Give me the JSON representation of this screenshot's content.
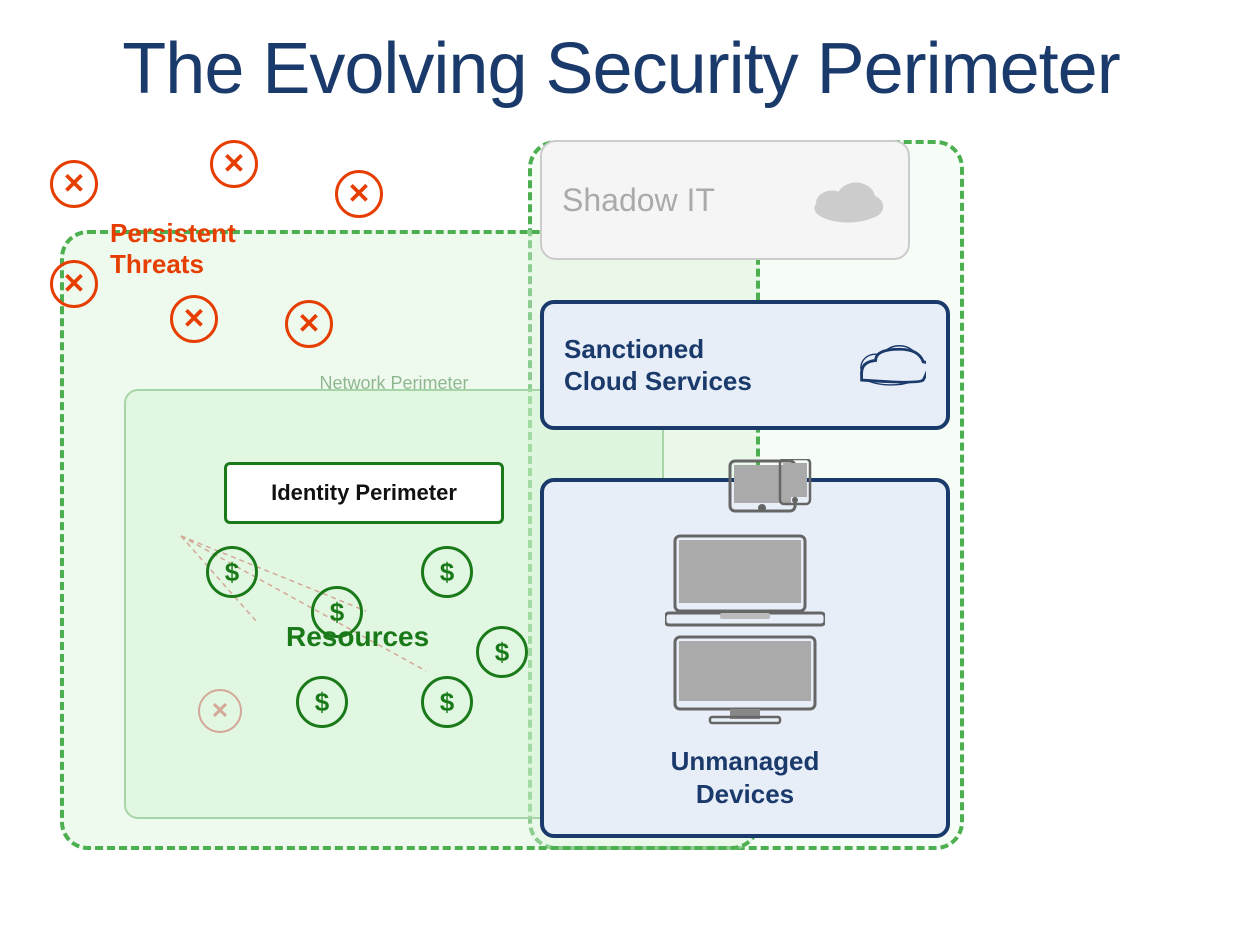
{
  "title": "The Evolving Security Perimeter",
  "zones": {
    "identity_perimeter": "Identity Perimeter",
    "network_perimeter": "Network Perimeter",
    "shadow_it": "Shadow IT",
    "sanctioned_cloud": {
      "line1": "Sanctioned",
      "line2": "Cloud Services",
      "combined": "Sanctioned\nCloud Services"
    },
    "unmanaged_devices": {
      "line1": "Unmanaged",
      "line2": "Devices"
    },
    "resources": "Resources",
    "persistent_threats": {
      "line1": "Persistent",
      "line2": "Threats"
    }
  },
  "colors": {
    "title": "#1a3a6b",
    "green_border": "#4caf50",
    "green_dark": "#1a7a1a",
    "navy": "#1a3a6b",
    "red": "#e53e00",
    "shadow_it": "#aaaaaa",
    "faded": "#d4a898"
  }
}
